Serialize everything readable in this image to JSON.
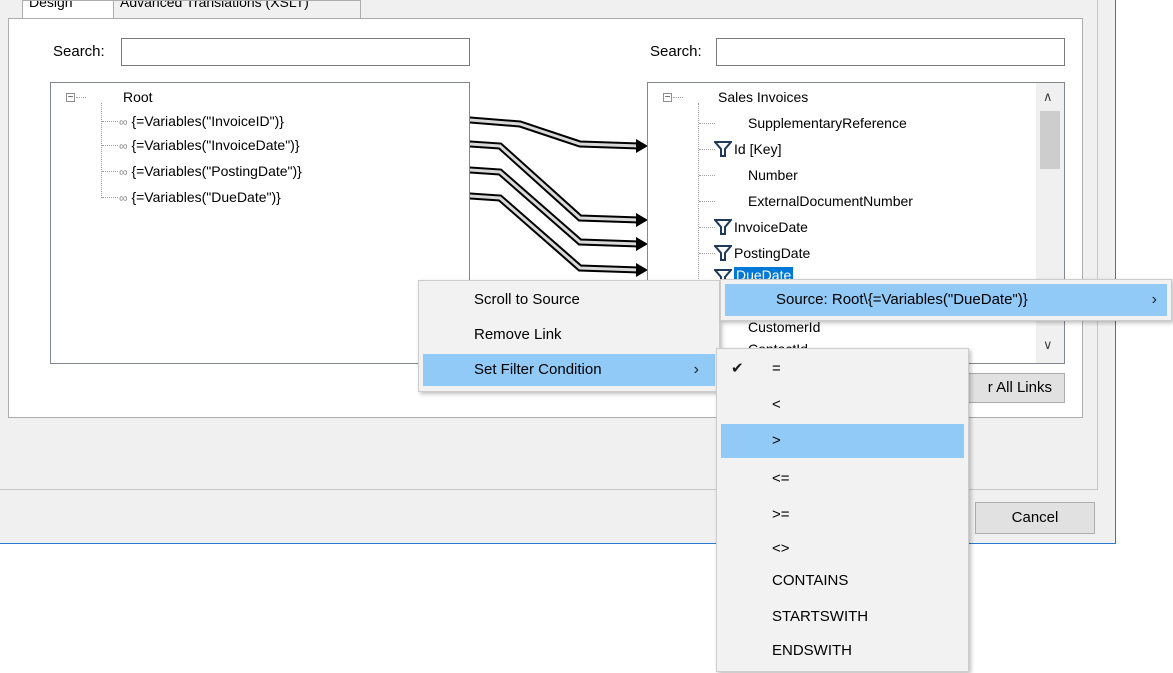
{
  "tabs": [
    {
      "label": "Design"
    },
    {
      "label": "Advanced Translations (XSLT)"
    }
  ],
  "left_panel": {
    "search_label": "Search:",
    "search_value": "",
    "root_label": "Root",
    "items": [
      {
        "label": "{=Variables(\"InvoiceID\")}"
      },
      {
        "label": "{=Variables(\"InvoiceDate\")}"
      },
      {
        "label": "{=Variables(\"PostingDate\")}"
      },
      {
        "label": "{=Variables(\"DueDate\")}"
      }
    ]
  },
  "right_panel": {
    "search_label": "Search:",
    "search_value": "",
    "root_label": "Sales Invoices",
    "items": [
      {
        "label": "SupplementaryReference",
        "filter": false
      },
      {
        "label": "Id [Key]",
        "filter": true
      },
      {
        "label": "Number",
        "filter": false
      },
      {
        "label": "ExternalDocumentNumber",
        "filter": false
      },
      {
        "label": "InvoiceDate",
        "filter": true
      },
      {
        "label": "PostingDate",
        "filter": true
      },
      {
        "label": "DueDate",
        "filter": true,
        "selected": true
      },
      {
        "label": "CustomerId",
        "filter": false
      },
      {
        "label": "ContactId",
        "filter": false
      }
    ]
  },
  "buttons": {
    "clear_all_links": "Clear All Links",
    "clear_all_links_visible": "r All Links",
    "cancel": "Cancel"
  },
  "context_menu": {
    "items": [
      {
        "label": "Scroll to Source"
      },
      {
        "label": "Remove Link"
      },
      {
        "label": "Set Filter Condition",
        "highlighted": true,
        "has_submenu": true
      }
    ]
  },
  "source_submenu": {
    "label": "Source: Root\\{=Variables(\"DueDate\")}"
  },
  "filter_submenu": {
    "checked_index": 0,
    "highlighted_index": 2,
    "items": [
      {
        "label": "="
      },
      {
        "label": "<"
      },
      {
        "label": ">"
      },
      {
        "label": "<="
      },
      {
        "label": ">="
      },
      {
        "label": "<>"
      },
      {
        "label": "CONTAINS"
      },
      {
        "label": "STARTSWITH"
      },
      {
        "label": "ENDSWITH"
      }
    ]
  },
  "colors": {
    "menu_highlight": "#91c9f7",
    "window_border": "#2b78d0",
    "selection": "#0078d7",
    "filter_icon": "#1f3a5a"
  }
}
